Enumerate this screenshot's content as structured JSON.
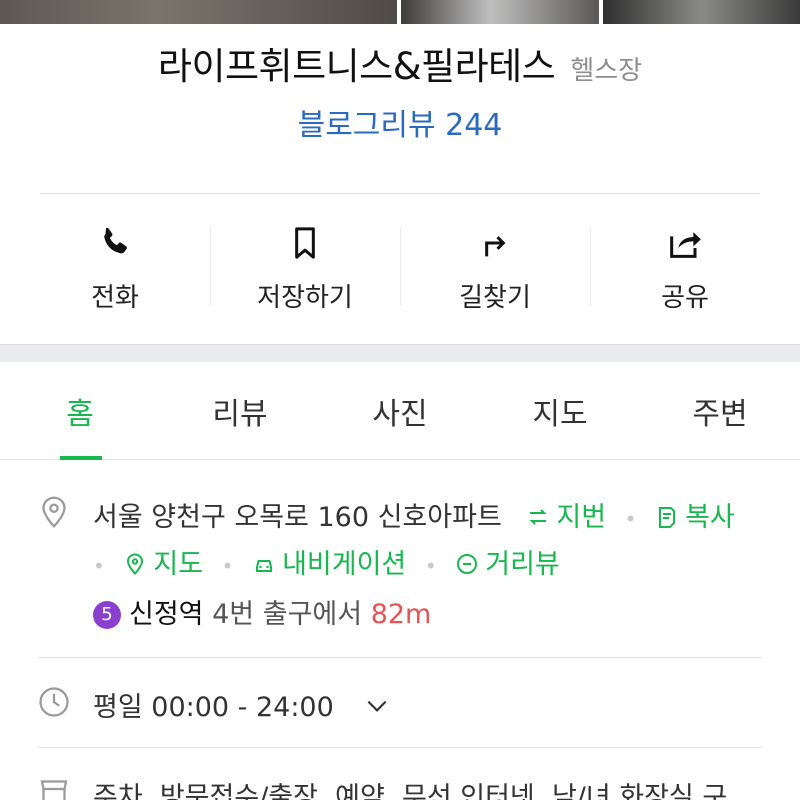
{
  "photos": [
    "photo-1",
    "photo-2",
    "photo-3"
  ],
  "place": {
    "name": "라이프휘트니스&필라테스",
    "category": "헬스장",
    "blog_review": "블로그리뷰 244"
  },
  "actions": [
    {
      "label": "전화",
      "icon": "phone-icon"
    },
    {
      "label": "저장하기",
      "icon": "bookmark-icon"
    },
    {
      "label": "길찾기",
      "icon": "directions-icon"
    },
    {
      "label": "공유",
      "icon": "share-icon"
    }
  ],
  "tabs": [
    {
      "label": "홈",
      "active": true
    },
    {
      "label": "리뷰",
      "active": false
    },
    {
      "label": "사진",
      "active": false
    },
    {
      "label": "지도",
      "active": false
    },
    {
      "label": "주변",
      "active": false
    }
  ],
  "address": {
    "text": "서울 양천구 오목로 160 신호아파트",
    "lot_link": "지번",
    "copy_link": "복사",
    "map_link": "지도",
    "navi_link": "내비게이션",
    "street_link": "거리뷰"
  },
  "subway": {
    "line": "5",
    "line_color": "#8b3fcf",
    "station": "신정역",
    "exit_text": "4번 출구에서",
    "distance": "82m"
  },
  "hours": {
    "text": "평일 00:00 - 24:00"
  },
  "amenities": {
    "text": "주차, 방문접수/출장, 예약, 무선 인터넷, 남/녀 화장실 구"
  },
  "colors": {
    "accent": "#19b74f",
    "link": "#2a6ac0",
    "distance": "#e45454"
  }
}
